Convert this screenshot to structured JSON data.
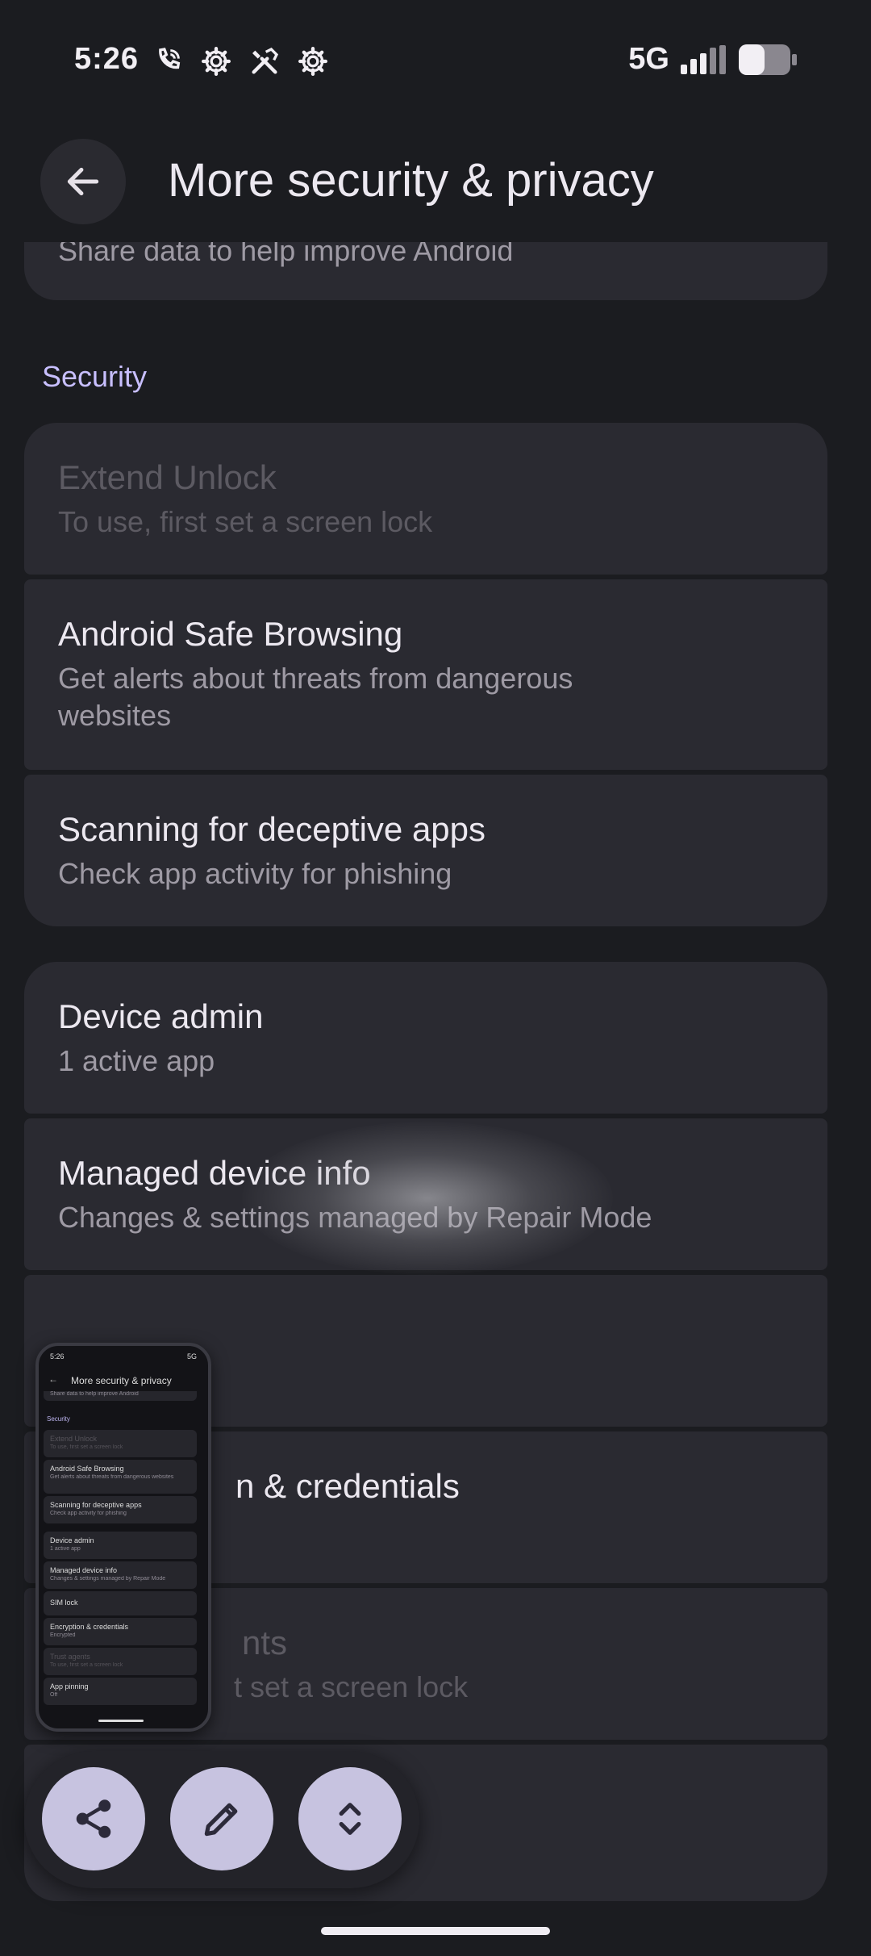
{
  "status_bar": {
    "time": "5:26",
    "network": "5G",
    "icons": [
      "wifi-calling-icon",
      "settings-icon",
      "tools-icon",
      "settings-icon"
    ]
  },
  "app_bar": {
    "title": "More security & privacy",
    "back_icon": "arrow-back-icon"
  },
  "top_card": {
    "subtitle": "Share data to help improve Android"
  },
  "section": {
    "security_label": "Security"
  },
  "items": [
    {
      "title": "Extend Unlock",
      "subtitle": "To use, first set a screen lock",
      "disabled": true
    },
    {
      "title": "Android Safe Browsing",
      "subtitle": "Get alerts about threats from dangerous websites",
      "disabled": false
    },
    {
      "title": "Scanning for deceptive apps",
      "subtitle": "Check app activity for phishing",
      "disabled": false
    },
    {
      "title": "Device admin",
      "subtitle": "1 active app",
      "disabled": false
    },
    {
      "title": "Managed device info",
      "subtitle": "Changes & settings managed by Repair Mode",
      "disabled": false
    },
    {
      "title": "",
      "subtitle": "",
      "disabled": false
    },
    {
      "title": "n & credentials",
      "subtitle": "",
      "disabled": false
    },
    {
      "title": "nts",
      "subtitle": "t set a screen lock",
      "disabled": true
    },
    {
      "title": "",
      "subtitle": "",
      "disabled": false
    }
  ],
  "thumbnail": {
    "time": "5:26",
    "network": "5G",
    "title": "More security & privacy",
    "top_subtitle": "Share data to help improve Android",
    "section": "Security",
    "rows": [
      {
        "title": "Extend Unlock",
        "subtitle": "To use, first set a screen lock"
      },
      {
        "title": "Android Safe Browsing",
        "subtitle": "Get alerts about threats from dangerous websites"
      },
      {
        "title": "Scanning for deceptive apps",
        "subtitle": "Check app activity for phishing"
      },
      {
        "title": "Device admin",
        "subtitle": "1 active app"
      },
      {
        "title": "Managed device info",
        "subtitle": "Changes & settings managed by Repair Mode"
      },
      {
        "title": "SIM lock",
        "subtitle": ""
      },
      {
        "title": "Encryption & credentials",
        "subtitle": "Encrypted"
      },
      {
        "title": "Trust agents",
        "subtitle": "To use, first set a screen lock"
      },
      {
        "title": "App pinning",
        "subtitle": "Off"
      }
    ]
  },
  "screenshot_actions": {
    "share_icon": "share-icon",
    "edit_icon": "edit-pencil-icon",
    "expand_icon": "expand-scroll-icon"
  },
  "colors": {
    "background": "#1b1c20",
    "card": "#2a2a31",
    "accent": "#c8bfff",
    "fab": "#c7c3e0"
  }
}
